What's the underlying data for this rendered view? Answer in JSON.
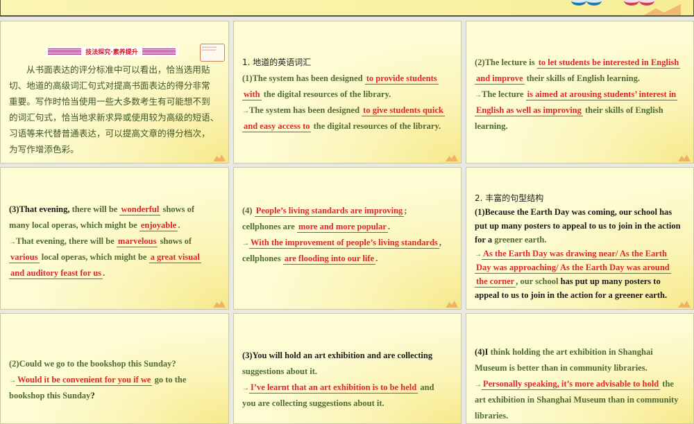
{
  "colors": {
    "text_green": "#4f6a33",
    "answer_red": "#e0262a",
    "text_black": "#1c1c1c",
    "panel_bg": "#fdfcd2"
  },
  "intro": {
    "banner": "技法探究·素养提升",
    "lines": [
      "从书面表达的评分标准中可以看出，恰当选用贴",
      "切、地道的高级词汇句式对提高书面表达的得分非常",
      "重要。写作时恰当使用一些大多数考生有可能想不到",
      "的词汇句式，恰当地求新求异或使用较为高级的短语、",
      "习语等来代替普通表达，可以提高文章的得分档次，",
      "为写作增添色彩。"
    ]
  },
  "panels": [
    {
      "id": "p2",
      "lines": [
        [
          {
            "t": "1.  地道的英语词汇",
            "c": "k"
          }
        ],
        [
          {
            "t": "(1)The system has been designed ",
            "c": "g"
          },
          {
            "t": "to provide students",
            "c": "r"
          }
        ],
        [
          {
            "t": "with",
            "c": "r"
          },
          {
            "t": " the digital resources of the library.",
            "c": "g"
          }
        ],
        [
          {
            "t": "→",
            "c": "arrow"
          },
          {
            "t": "The system has been designed ",
            "c": "g"
          },
          {
            "t": "to give students quick",
            "c": "r"
          }
        ],
        [
          {
            "t": "and easy access to",
            "c": "r"
          },
          {
            "t": " the digital resources of the library.",
            "c": "g"
          }
        ]
      ]
    },
    {
      "id": "p3",
      "lines": [
        [
          {
            "t": "(2)The lecture is ",
            "c": "g"
          },
          {
            "t": "to let students be interested in English",
            "c": "r"
          }
        ],
        [
          {
            "t": "and improve",
            "c": "r"
          },
          {
            "t": " their skills of English learning.",
            "c": "g"
          }
        ],
        [
          {
            "t": "→",
            "c": "arrow"
          },
          {
            "t": "The lecture ",
            "c": "g"
          },
          {
            "t": "is aimed at arousing students’ interest in",
            "c": "r"
          }
        ],
        [
          {
            "t": "English as well as improving",
            "c": "r"
          },
          {
            "t": "  their skills of English",
            "c": "g"
          }
        ],
        [
          {
            "t": "learning.",
            "c": "g"
          }
        ]
      ]
    },
    {
      "id": "p4",
      "lines": [
        [
          {
            "t": "(3)That evening,",
            "c": "k"
          },
          {
            "t": "  there will be ",
            "c": "g"
          },
          {
            "t": "wonderful",
            "c": "r"
          },
          {
            "t": " shows of",
            "c": "g"
          }
        ],
        [
          {
            "t": "many local operas,  which might be ",
            "c": "g"
          },
          {
            "t": "enjoyable",
            "c": "r"
          },
          {
            "t": ".",
            "c": "g"
          }
        ],
        [
          {
            "t": "→",
            "c": "arrow"
          },
          {
            "t": "That evening,  there will be ",
            "c": "g"
          },
          {
            "t": "marvelous",
            "c": "r"
          },
          {
            "t": " shows of",
            "c": "g"
          }
        ],
        [
          {
            "t": "various",
            "c": "r"
          },
          {
            "t": " local operas,  which might be ",
            "c": "g"
          },
          {
            "t": "a great visual",
            "c": "r"
          }
        ],
        [
          {
            "t": "and auditory feast for us",
            "c": "r"
          },
          {
            "t": ".",
            "c": "g"
          }
        ]
      ]
    },
    {
      "id": "p5",
      "lines": [
        [
          {
            "t": "(4)  ",
            "c": "g"
          },
          {
            "t": "People’s living standards are improving",
            "c": "r"
          },
          {
            "t": ";",
            "c": "g"
          }
        ],
        [
          {
            "t": "cellphones are ",
            "c": "g"
          },
          {
            "t": "more and more popular",
            "c": "r"
          },
          {
            "t": ".",
            "c": "g"
          }
        ],
        [
          {
            "t": "→",
            "c": "arrow"
          },
          {
            "t": "With the improvement of people’s living standards",
            "c": "r"
          },
          {
            "t": ",",
            "c": "g"
          }
        ],
        [
          {
            "t": "cellphones ",
            "c": "g"
          },
          {
            "t": "are flooding into our life",
            "c": "r"
          },
          {
            "t": ".",
            "c": "g"
          }
        ]
      ]
    },
    {
      "id": "p6",
      "lines": [
        [
          {
            "t": "2.  丰富的句型结构",
            "c": "k"
          }
        ],
        [
          {
            "t": "(1)Because the Earth Day was coming,  our school has",
            "c": "k"
          }
        ],
        [
          {
            "t": "put up many posters to appeal to us to join in the action",
            "c": "k"
          }
        ],
        [
          {
            "t": "for a ",
            "c": "k"
          },
          {
            "t": "greener earth.",
            "c": "g"
          }
        ],
        [
          {
            "t": "→",
            "c": "arrow"
          },
          {
            "t": "As the Earth Day was drawing near/ As the Earth",
            "c": "r"
          }
        ],
        [
          {
            "t": "Day was approaching/ As the Earth Day was around",
            "c": "r"
          }
        ],
        [
          {
            "t": "the corner",
            "c": "r"
          },
          {
            "t": ",  our school",
            "c": "g"
          },
          {
            "t": " has put up many posters to",
            "c": "k"
          }
        ],
        [
          {
            "t": "appeal to us to join in the action for a greener earth.",
            "c": "k"
          }
        ]
      ]
    },
    {
      "id": "p7",
      "lines": [
        [
          {
            "t": "(2)Could we go to the bookshop this Sunday?",
            "c": "g"
          }
        ],
        [
          {
            "t": "→",
            "c": "arrow"
          },
          {
            "t": "Would it be convenient for you if we",
            "c": "r"
          },
          {
            "t": " go to the",
            "c": "g"
          }
        ],
        [
          {
            "t": "bookshop this Sunday",
            "c": "g"
          },
          {
            "t": "?",
            "c": "k"
          }
        ]
      ]
    },
    {
      "id": "p8",
      "lines": [
        [
          {
            "t": "(3)You will hold an art exhibition and are collecting",
            "c": "k"
          }
        ],
        [
          {
            "t": "suggestions about it.",
            "c": "g"
          }
        ],
        [
          {
            "t": "→",
            "c": "arrow"
          },
          {
            "t": "I’ve learnt that an art exhibition is to be held",
            "c": "r"
          },
          {
            "t": "  and",
            "c": "g"
          }
        ],
        [
          {
            "t": "you are collecting suggestions about it.",
            "c": "g"
          }
        ]
      ]
    },
    {
      "id": "p9",
      "lines": [
        [
          {
            "t": "(4)I",
            "c": "k"
          },
          {
            "t": " think holding the art exhibition in Shanghai",
            "c": "g"
          }
        ],
        [
          {
            "t": "Museum is better than in community libraries.",
            "c": "g"
          }
        ],
        [
          {
            "t": "→",
            "c": "arrow"
          },
          {
            "t": "Personally speaking,  it’s more advisable to hold",
            "c": "r"
          },
          {
            "t": "  the",
            "c": "g"
          }
        ],
        [
          {
            "t": "art exhibition in Shanghai Museum than in community",
            "c": "g"
          }
        ],
        [
          {
            "t": "libraries.",
            "c": "g"
          }
        ]
      ]
    }
  ]
}
